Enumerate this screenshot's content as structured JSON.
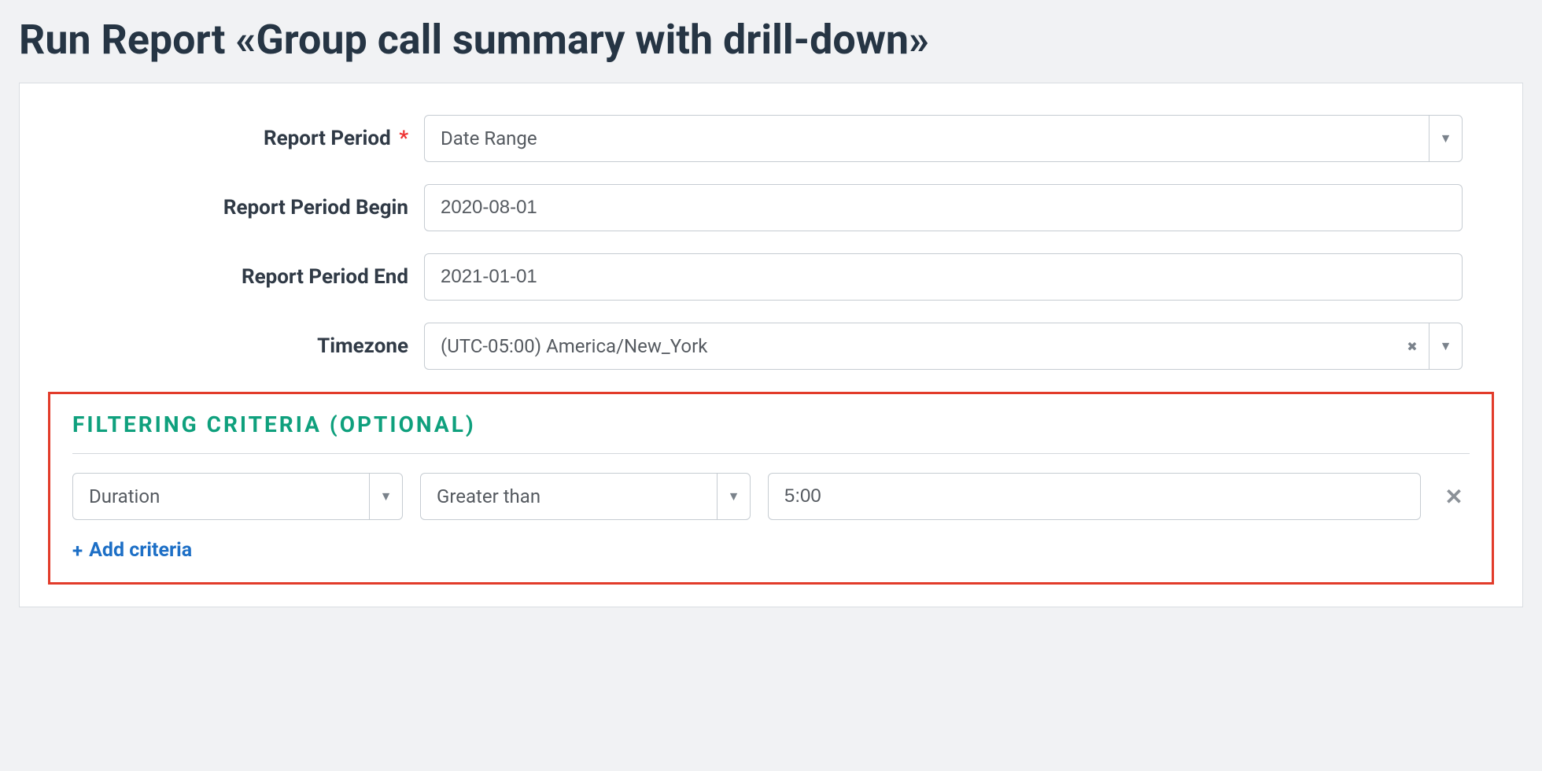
{
  "page": {
    "title": "Run Report «Group call summary with drill-down»"
  },
  "form": {
    "report_period": {
      "label": "Report Period",
      "required_mark": "*",
      "value": "Date Range"
    },
    "report_period_begin": {
      "label": "Report Period Begin",
      "value": "2020-08-01"
    },
    "report_period_end": {
      "label": "Report Period End",
      "value": "2021-01-01"
    },
    "timezone": {
      "label": "Timezone",
      "value": "(UTC-05:00) America/New_York"
    }
  },
  "filter": {
    "heading": "FILTERING  CRITERIA  (OPTIONAL)",
    "criteria": [
      {
        "field": "Duration",
        "operator": "Greater than",
        "value": "5:00"
      }
    ],
    "add_label": "Add criteria"
  },
  "glyphs": {
    "caret": "▼",
    "clear": "✖",
    "plus": "+",
    "close": "✕"
  }
}
